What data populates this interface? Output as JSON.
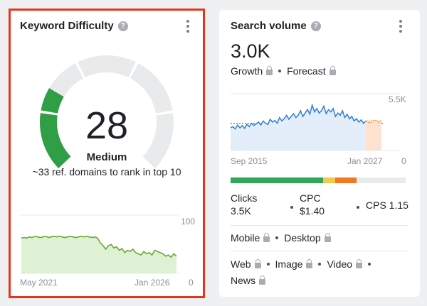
{
  "keyword_difficulty": {
    "title": "Keyword Difficulty",
    "help_icon": "?",
    "score": "28",
    "level": "Medium",
    "subtitle": "~33 ref. domains to rank in top 10",
    "gauge_fraction": 0.28,
    "colors": {
      "gauge_fill": "#2f9e44",
      "gauge_track": "#e9eaec",
      "line": "#6aa832",
      "fill": "#dff1d5"
    },
    "history": {
      "x_start": "May 2021",
      "x_end": "Jan 2026",
      "y_max": "100",
      "y_min": "0"
    }
  },
  "search_volume": {
    "title": "Search volume",
    "help_icon": "?",
    "value": "3.0K",
    "growth_label": "Growth",
    "forecast_label": "Forecast",
    "colors": {
      "line": "#2f7fd0",
      "fill": "#e3eefa",
      "forecast": "#ef8a3c"
    },
    "chart": {
      "x_start": "Sep 2015",
      "x_end": "Jan 2027",
      "y_max": "5.5K",
      "y_min": "0"
    },
    "intent_bar": [
      {
        "color": "#2fa65a",
        "fraction": 0.53
      },
      {
        "color": "#f2c94c",
        "fraction": 0.07
      },
      {
        "color": "#f07a22",
        "fraction": 0.12
      },
      {
        "color": "#e9eaec",
        "fraction": 0.28
      }
    ],
    "clicks_label": "Clicks",
    "clicks_value": "3.5K",
    "cpc_label": "CPC",
    "cpc_value": "$1.40",
    "cps_label": "CPS 1.15",
    "devices": [
      "Mobile",
      "Desktop"
    ],
    "serp_types": [
      "Web",
      "Image",
      "Video",
      "News"
    ]
  }
}
